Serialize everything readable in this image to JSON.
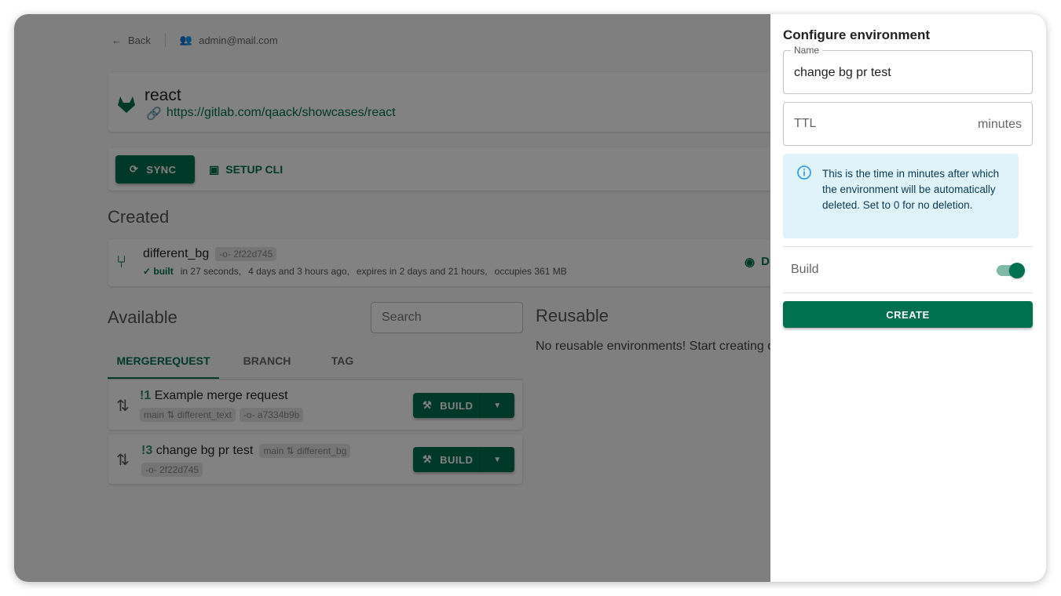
{
  "topbar": {
    "back": "Back",
    "user": "admin@mail.com"
  },
  "project": {
    "name": "react",
    "url": "https://gitlab.com/qaack/showcases/react"
  },
  "actions": {
    "sync": "SYNC",
    "setup_cli": "SETUP CLI"
  },
  "created": {
    "title": "Created",
    "env": {
      "name": "different_bg",
      "commit": "2f22d745",
      "status": "built",
      "duration": "in 27 seconds,",
      "age": "4 days and 3 hours ago,",
      "expires": "expires in 2 days and 21 hours,",
      "size": "occupies 361 MB",
      "action_partial": "D"
    }
  },
  "available": {
    "title": "Available",
    "search_placeholder": "Search",
    "tabs": [
      "MERGEREQUEST",
      "BRANCH",
      "TAG"
    ],
    "items": [
      {
        "id": "!1",
        "title": "Example merge request",
        "target": "main",
        "source": "different_text",
        "commit": "a7334b9b",
        "build": "BUILD"
      },
      {
        "id": "!3",
        "title": "change bg pr test",
        "target": "main",
        "source": "different_bg",
        "commit": "2f22d745",
        "build": "BUILD"
      }
    ]
  },
  "reusable": {
    "title": "Reusable",
    "empty": "No reusable environments! Start creating o"
  },
  "drawer": {
    "title": "Configure environment",
    "name_label": "Name",
    "name_value": "change bg pr test",
    "ttl_label": "TTL",
    "ttl_unit": "minutes",
    "info": "This is the time in minutes after which the environment will be automatically deleted. Set to 0 for no deletion.",
    "build_label": "Build",
    "build_enabled": true,
    "create": "CREATE"
  },
  "colors": {
    "primary": "#00704f",
    "info_bg": "#e0f3fb",
    "info_icon": "#2196f3"
  }
}
